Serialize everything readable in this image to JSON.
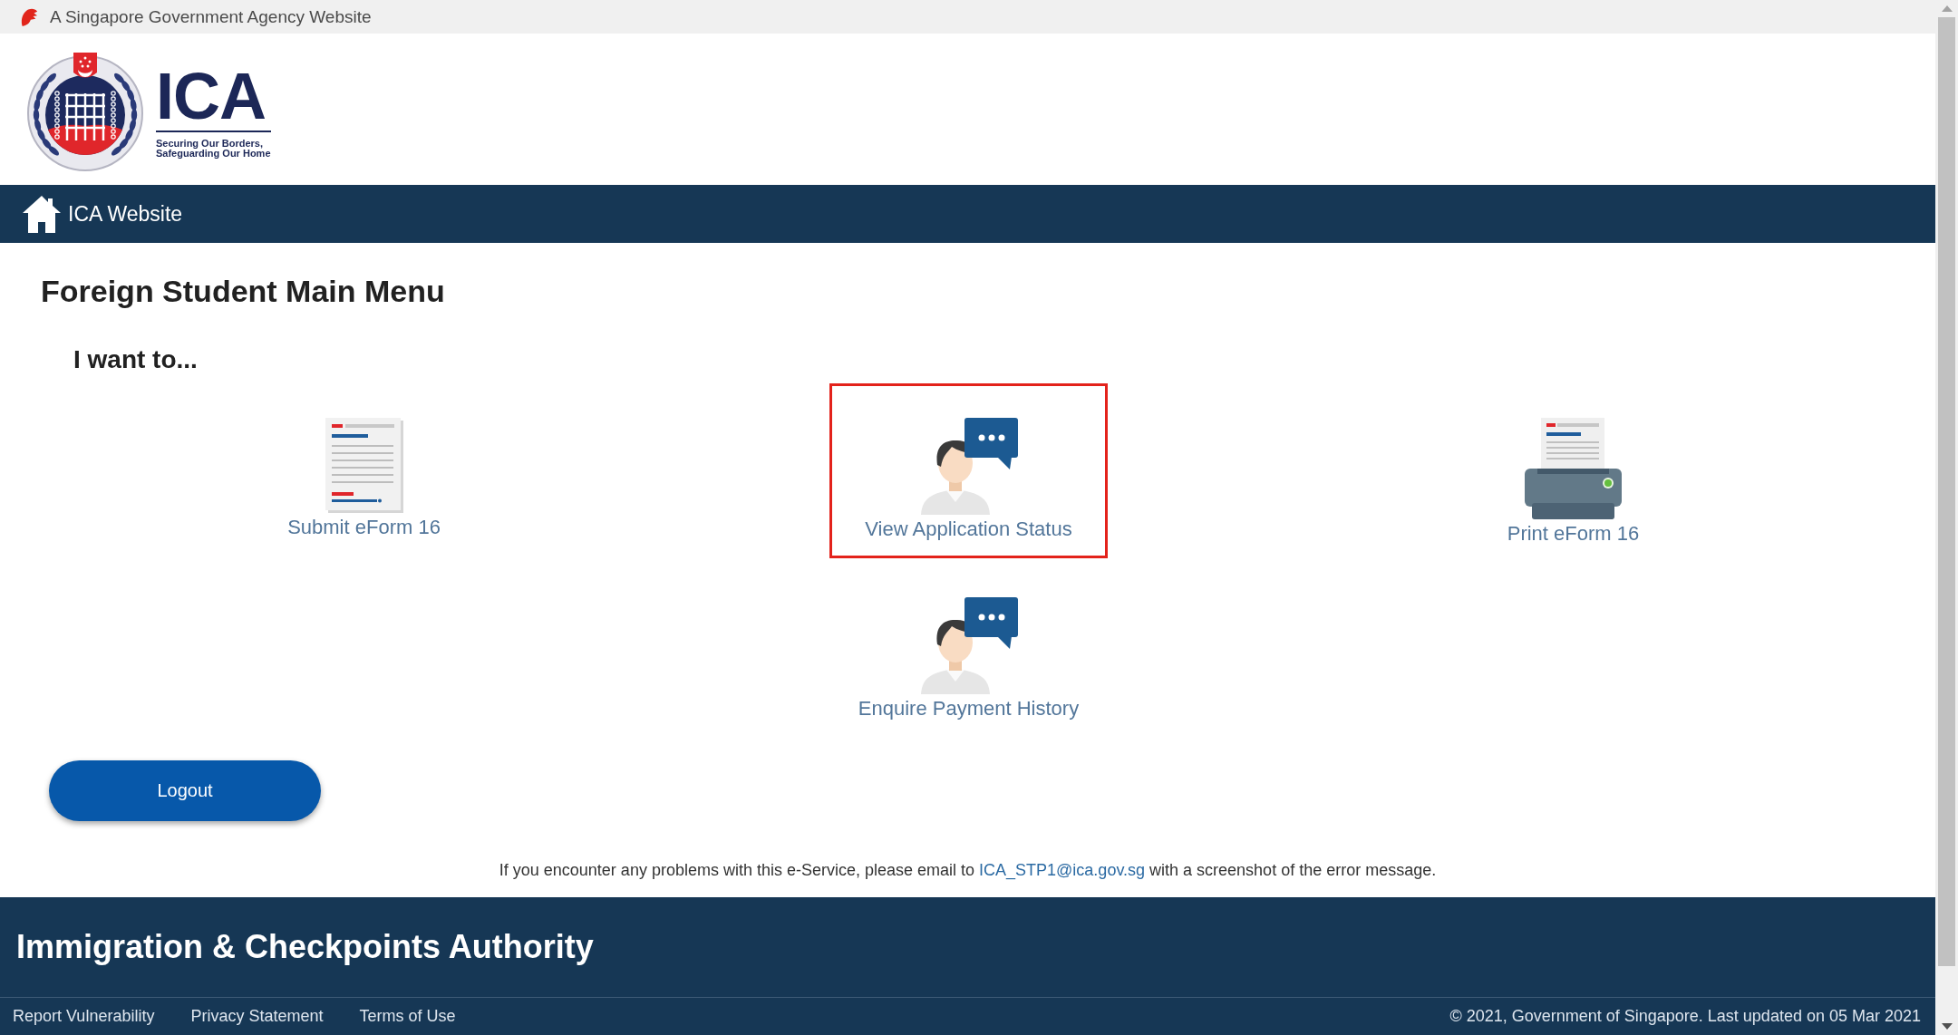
{
  "top_banner": {
    "text": "A Singapore Government Agency Website"
  },
  "header": {
    "logo": {
      "wordmark": "ICA",
      "tagline": [
        "Securing Our Borders,",
        "Safeguarding Our Home"
      ]
    }
  },
  "nav_bar": {
    "home_link": "ICA Website"
  },
  "page_title": "Foreign Student Main Menu",
  "section_heading": "I want to...",
  "menu_items": [
    {
      "label": "Submit eForm 16",
      "kind": "document",
      "highlighted": false
    },
    {
      "label": "View Application Status",
      "kind": "person",
      "highlighted": true
    },
    {
      "label": "Print eForm 16",
      "kind": "printer",
      "highlighted": false
    },
    {
      "label": "Enquire Payment History",
      "kind": "person",
      "highlighted": false
    }
  ],
  "logout_button": {
    "label": "Logout"
  },
  "help_message": {
    "before": "If you encounter any problems with this e-Service, please email to ",
    "link": "ICA_STP1@ica.gov.sg",
    "after": " with a screenshot of the error message."
  },
  "footer": {
    "title": "Immigration & Checkpoints Authority",
    "links": [
      "Report Vulnerability",
      "Privacy Statement",
      "Terms of Use"
    ],
    "copyright": "© 2021, Government of Singapore. Last updated on 05 Mar 2021"
  }
}
